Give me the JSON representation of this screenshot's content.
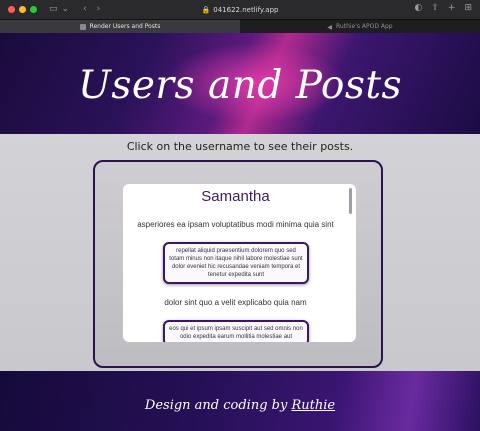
{
  "browser": {
    "url": "041622.netlify.app",
    "tabs": [
      {
        "label": "Render Users and Posts",
        "active": true
      },
      {
        "label": "Ruthie's APOD App",
        "active": false
      }
    ],
    "colors": {
      "close": "#ff5f57",
      "minimize": "#febc2e",
      "zoom": "#28c840"
    }
  },
  "page": {
    "title": "Users and Posts",
    "instruction": "Click on the username to see their posts.",
    "user": {
      "name": "Samantha",
      "posts": [
        {
          "title": "asperiores ea ipsam voluptatibus modi minima quia sint",
          "body": "repellat aliquid praesentium dolorem quo sed totam minus non itaque nihil labore molestiae sunt dolor eveniet hic recusandae veniam tempora et tenetur expedita sunt"
        },
        {
          "title": "dolor sint quo a velit explicabo quia nam",
          "body": "eos qui et ipsum ipsam suscipit aut sed omnis non odio expedita earum mollitia molestiae aut"
        }
      ]
    },
    "footer": {
      "prefix": "Design and coding by ",
      "link": "Ruthie"
    },
    "accent": "#3f1c5e"
  }
}
